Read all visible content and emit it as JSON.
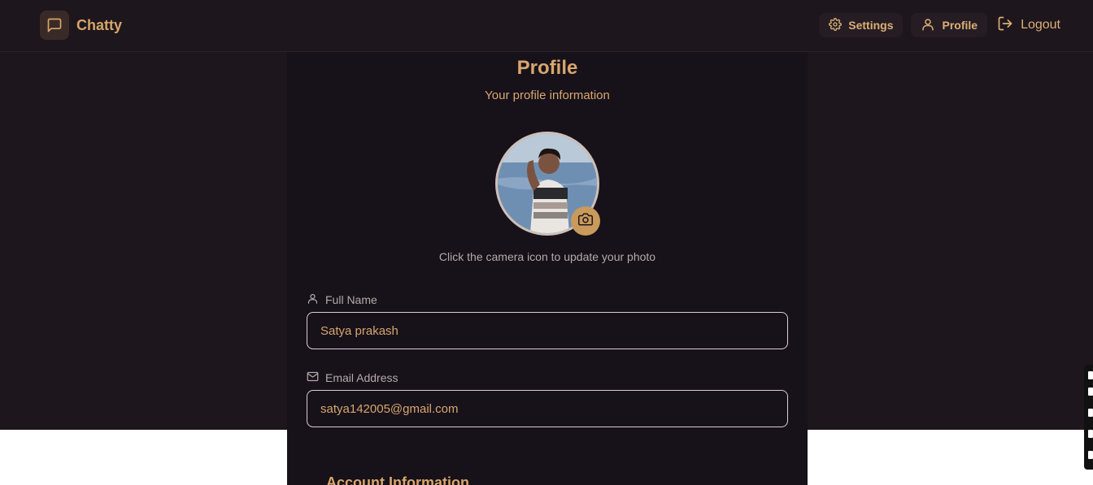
{
  "app": {
    "name": "Chatty"
  },
  "nav": {
    "settings_label": "Settings",
    "profile_label": "Profile",
    "logout_label": "Logout"
  },
  "profile": {
    "title": "Profile",
    "subtitle": "Your profile information",
    "photo_hint": "Click the camera icon to update your photo",
    "full_name_label": "Full Name",
    "full_name_value": "Satya prakash",
    "email_label": "Email Address",
    "email_value": "satya142005@gmail.com",
    "account_section_title": "Account Information"
  },
  "colors": {
    "background": "#1e161d",
    "panel": "#17111a",
    "accent": "#d8a76c",
    "camera_button": "#c99a5b"
  },
  "icons": {
    "brand": "message-square-icon",
    "settings": "gear-icon",
    "profile": "user-icon",
    "logout": "logout-icon",
    "camera": "camera-icon",
    "full_name": "user-icon",
    "email": "mail-icon"
  }
}
